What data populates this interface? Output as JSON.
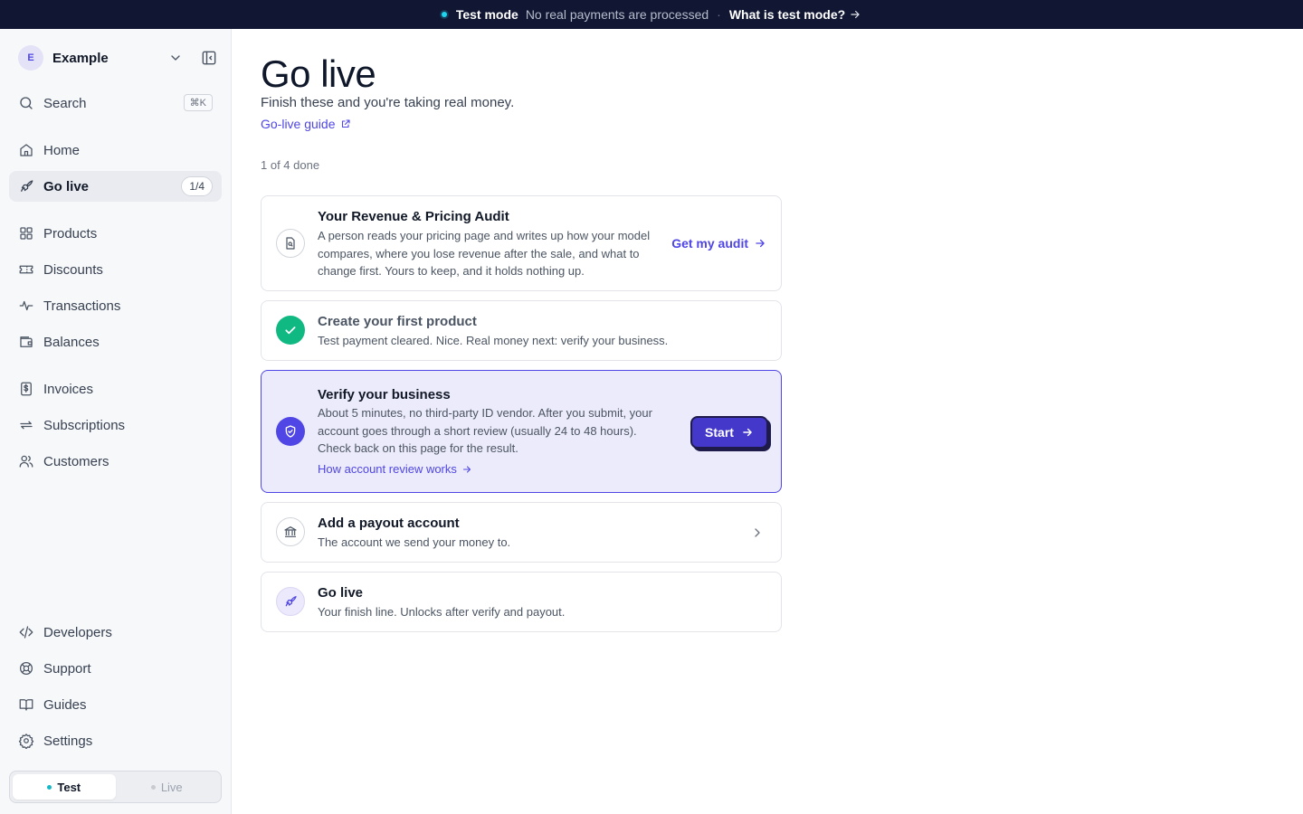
{
  "banner": {
    "title": "Test mode",
    "message": "No real payments are processed",
    "separator": "·",
    "link": "What is test mode?"
  },
  "workspace": {
    "initial": "E",
    "name": "Example"
  },
  "sidebar": {
    "search": {
      "label": "Search",
      "shortcut": "⌘K"
    },
    "nav": [
      {
        "label": "Home",
        "icon": "home-icon"
      },
      {
        "label": "Go live",
        "icon": "rocket-icon",
        "badge": "1/4",
        "active": true
      },
      {
        "label": "Products",
        "icon": "grid-icon"
      },
      {
        "label": "Discounts",
        "icon": "ticket-icon"
      },
      {
        "label": "Transactions",
        "icon": "activity-icon"
      },
      {
        "label": "Balances",
        "icon": "wallet-icon"
      },
      {
        "label": "Invoices",
        "icon": "dollar-doc-icon"
      },
      {
        "label": "Subscriptions",
        "icon": "repeat-icon"
      },
      {
        "label": "Customers",
        "icon": "users-icon"
      }
    ],
    "footer": [
      {
        "label": "Developers",
        "icon": "code-icon"
      },
      {
        "label": "Support",
        "icon": "lifebuoy-icon"
      },
      {
        "label": "Guides",
        "icon": "book-icon"
      },
      {
        "label": "Settings",
        "icon": "gear-icon"
      }
    ],
    "mode": {
      "test": "Test",
      "live": "Live",
      "selected": "Test"
    }
  },
  "page": {
    "title": "Go live",
    "subtitle": "Finish these and you're taking real money.",
    "guide_link": "Go-live guide",
    "progress": "1 of 4 done"
  },
  "steps": [
    {
      "title": "Your Revenue & Pricing Audit",
      "description": "A person reads your pricing page and writes up how your model compares, where you lose revenue after the sale, and what to change first. Yours to keep, and it holds nothing up.",
      "action": "Get my audit",
      "icon": "document-search-icon"
    },
    {
      "title": "Create your first product",
      "description": "Test payment cleared. Nice. Real money next: verify your business.",
      "status": "done",
      "icon": "check-icon"
    },
    {
      "title": "Verify your business",
      "description": "About 5 minutes, no third-party ID vendor. After you submit, your account goes through a short review (usually 24 to 48 hours). Check back on this page for the result.",
      "link": "How account review works",
      "action": "Start",
      "status": "current",
      "icon": "shield-check-icon"
    },
    {
      "title": "Add a payout account",
      "description": "The account we send your money to.",
      "icon": "bank-icon"
    },
    {
      "title": "Go live",
      "description": "Your finish line. Unlocks after verify and payout.",
      "icon": "rocket-icon"
    }
  ],
  "colors": {
    "accent": "#4f46e5",
    "banner_bg": "#111733",
    "success": "#10b981",
    "test_dot": "#22d3ee"
  }
}
